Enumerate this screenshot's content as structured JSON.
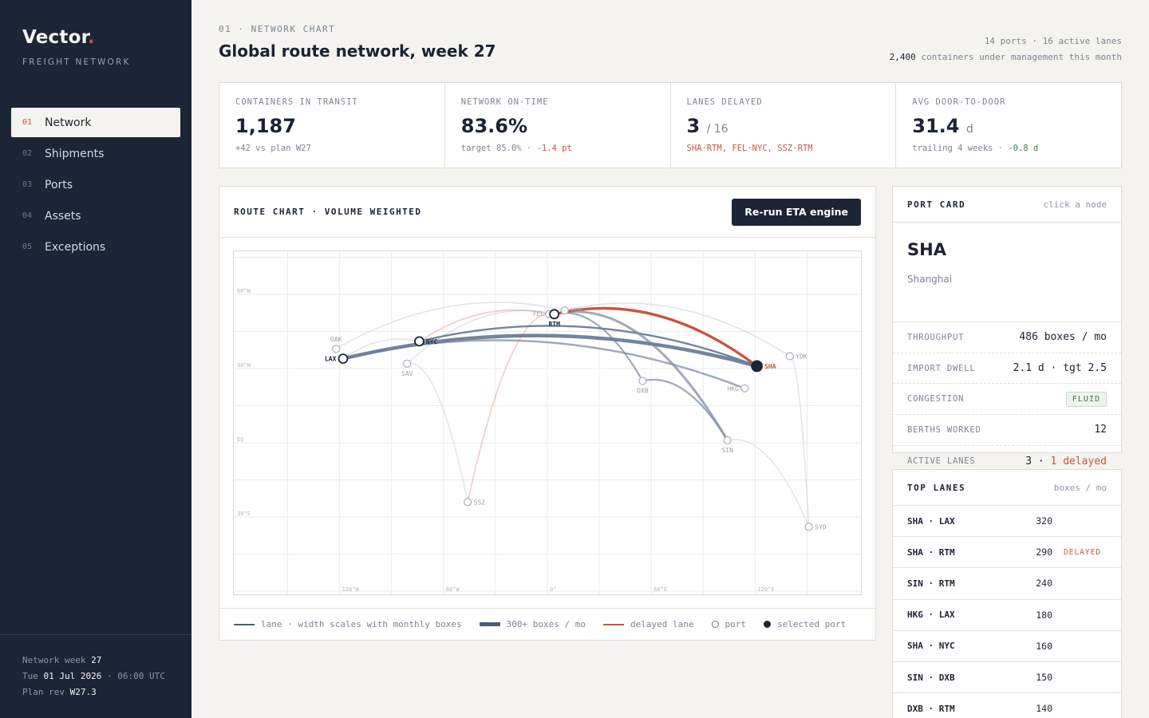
{
  "brand": {
    "name": "Vector",
    "dot": ".",
    "subtitle": "FREIGHT NETWORK"
  },
  "nav": [
    {
      "num": "01",
      "label": "Network",
      "active": true
    },
    {
      "num": "02",
      "label": "Shipments"
    },
    {
      "num": "03",
      "label": "Ports"
    },
    {
      "num": "04",
      "label": "Assets"
    },
    {
      "num": "05",
      "label": "Exceptions"
    }
  ],
  "footer": {
    "week_label": "Network week",
    "week": "27",
    "day": "Tue",
    "date": "01 Jul 2026",
    "time": "· 06:00 UTC",
    "plan_label": "Plan rev",
    "plan": "W27.3"
  },
  "header": {
    "eyebrow": "01 · NETWORK CHART",
    "title": "Global route network, week 27",
    "meta_line1": "14 ports · 16 active lanes",
    "meta_count": "2,400",
    "meta_line2": "containers under management this month"
  },
  "kpis": [
    {
      "label": "CONTAINERS IN TRANSIT",
      "value": "1,187",
      "of": "",
      "sub": "+42 vs plan W27",
      "sub_flag": ""
    },
    {
      "label": "NETWORK ON-TIME",
      "value": "83.6%",
      "of": "",
      "sub": "target 85.0% · ",
      "sub_flag": "-1.4 pt"
    },
    {
      "label": "LANES DELAYED",
      "value": "3",
      "of": "/ 16",
      "sub": "",
      "sub_flag": "SHA·RTM, FEL·NYC, SSZ·RTM"
    },
    {
      "label": "AVG DOOR-TO-DOOR",
      "value": "31.4",
      "of": "d",
      "sub": "trailing 4 weeks · ",
      "sub_flag": "-0.8 d"
    }
  ],
  "route_chart": {
    "title": "ROUTE CHART · VOLUME WEIGHTED",
    "button": "Re-run ETA engine",
    "lat_labels": [
      "60°N",
      "30°N",
      "EQ",
      "30°S"
    ],
    "lon_labels": [
      "120°W",
      "60°W",
      "0°",
      "60°E",
      "120°E"
    ],
    "ports": [
      {
        "code": "LAX",
        "lon": -118,
        "lat": 34,
        "major": true
      },
      {
        "code": "OAK",
        "lon": -122,
        "lat": 38
      },
      {
        "code": "NYC",
        "lon": -74,
        "lat": 41,
        "major": true
      },
      {
        "code": "SAV",
        "lon": -81,
        "lat": 32
      },
      {
        "code": "SSZ",
        "lon": -46,
        "lat": -24
      },
      {
        "code": "FEL",
        "lon": 1,
        "lat": 52
      },
      {
        "code": "RTM",
        "lon": 4,
        "lat": 52,
        "major": true
      },
      {
        "code": "HAM",
        "lon": 10,
        "lat": 53.5
      },
      {
        "code": "DXB",
        "lon": 55,
        "lat": 25
      },
      {
        "code": "HKG",
        "lon": 114,
        "lat": 22
      },
      {
        "code": "SHA",
        "lon": 121,
        "lat": 31,
        "selected": true
      },
      {
        "code": "SIN",
        "lon": 104,
        "lat": 1
      },
      {
        "code": "YOK",
        "lon": 140,
        "lat": 35
      },
      {
        "code": "SYD",
        "lon": 151,
        "lat": -34
      }
    ],
    "lanes": [
      {
        "from": "SHA",
        "to": "LAX",
        "boxes": 320
      },
      {
        "from": "SHA",
        "to": "RTM",
        "boxes": 290,
        "delayed": true
      },
      {
        "from": "SIN",
        "to": "RTM",
        "boxes": 240
      },
      {
        "from": "HKG",
        "to": "LAX",
        "boxes": 180
      },
      {
        "from": "SHA",
        "to": "NYC",
        "boxes": 160
      },
      {
        "from": "SIN",
        "to": "DXB",
        "boxes": 150
      },
      {
        "from": "DXB",
        "to": "RTM",
        "boxes": 140
      },
      {
        "from": "FEL",
        "to": "NYC",
        "boxes": 110,
        "delayed": true
      },
      {
        "from": "SSZ",
        "to": "RTM",
        "boxes": 90,
        "delayed": true
      },
      {
        "from": "SAV",
        "to": "SSZ",
        "boxes": 60
      },
      {
        "from": "YOK",
        "to": "SYD",
        "boxes": 60
      },
      {
        "from": "SIN",
        "to": "SYD",
        "boxes": 60
      },
      {
        "from": "HAM",
        "to": "YOK",
        "boxes": 70
      },
      {
        "from": "OAK",
        "to": "HAM",
        "boxes": 70
      },
      {
        "from": "RTM",
        "to": "SAV",
        "boxes": 60
      },
      {
        "from": "LAX",
        "to": "NYC",
        "boxes": 80
      }
    ],
    "legend": {
      "lane": "lane · width scales with monthly boxes",
      "heavy": "300+ boxes / mo",
      "delayed": "delayed lane",
      "port": "port",
      "selected": "selected port"
    }
  },
  "port_card": {
    "title": "PORT CARD",
    "hint": "click a node",
    "code": "SHA",
    "name": "Shanghai",
    "throughput_label": "THROUGHPUT",
    "throughput": "486 boxes / mo",
    "dwell_label": "IMPORT DWELL",
    "dwell": "2.1 d · tgt 2.5",
    "congestion_label": "CONGESTION",
    "congestion": "FLUID",
    "berths_label": "BERTHS WORKED",
    "berths": "12",
    "lanes_label": "ACTIVE LANES",
    "lanes_count": "3 ·",
    "lanes_delayed": "1 delayed"
  },
  "top_lanes": {
    "title": "TOP LANES",
    "unit": "boxes / mo",
    "rows": [
      {
        "lane": "SHA · LAX",
        "boxes": "320",
        "flag": ""
      },
      {
        "lane": "SHA · RTM",
        "boxes": "290",
        "flag": "DELAYED"
      },
      {
        "lane": "SIN · RTM",
        "boxes": "240",
        "flag": ""
      },
      {
        "lane": "HKG · LAX",
        "boxes": "180",
        "flag": ""
      },
      {
        "lane": "SHA · NYC",
        "boxes": "160",
        "flag": ""
      },
      {
        "lane": "SIN · DXB",
        "boxes": "150",
        "flag": ""
      },
      {
        "lane": "DXB · RTM",
        "boxes": "140",
        "flag": ""
      }
    ]
  }
}
